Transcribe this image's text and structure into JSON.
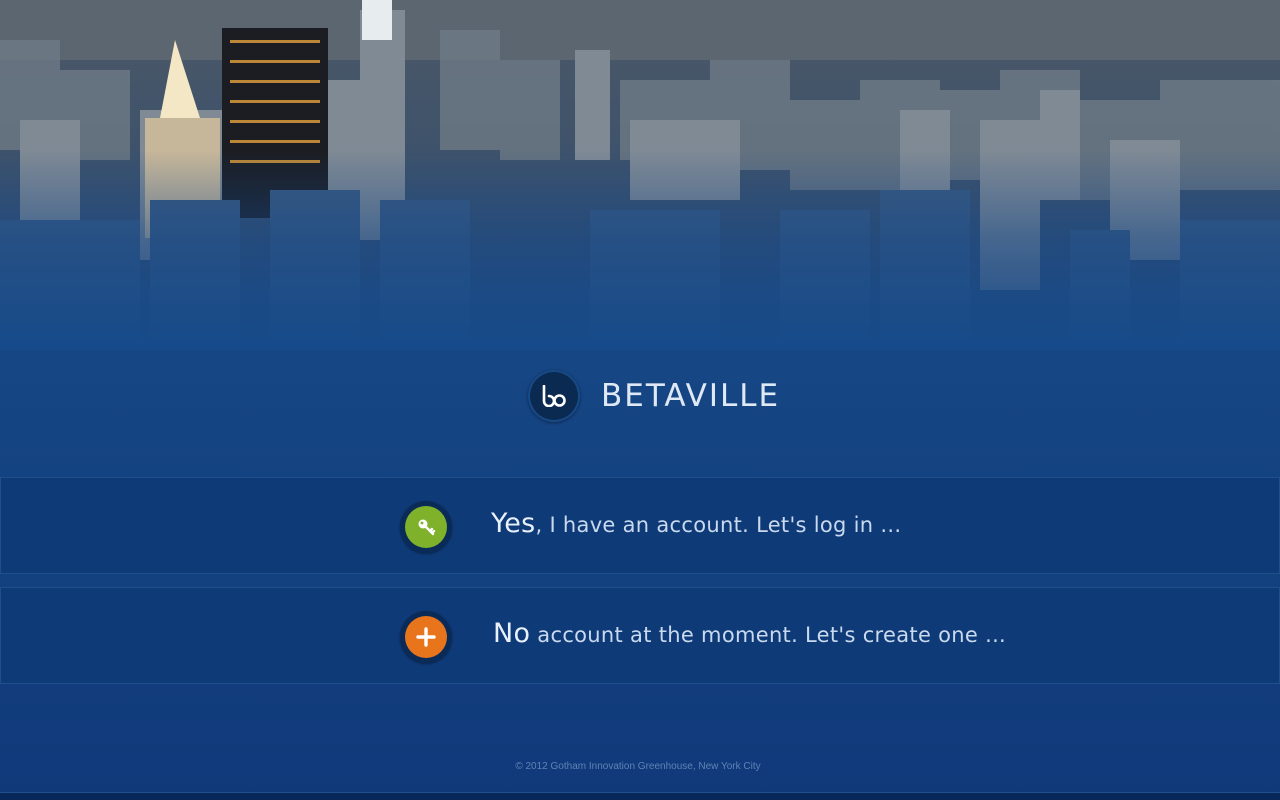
{
  "brand": {
    "logo_text": "bo",
    "name": "BETAVILLE"
  },
  "options": {
    "login": {
      "lead": "Yes",
      "rest": ", I have an account. Let's log in ...",
      "icon": "key-icon",
      "color": "#7fb22a"
    },
    "create": {
      "lead": "No",
      "rest": " account at the moment. Let's create one ...",
      "icon": "plus-icon",
      "color": "#e8741c"
    }
  },
  "footer": {
    "copyright": "© 2012 Gotham Innovation Greenhouse, New York City"
  },
  "colors": {
    "background": "#164684",
    "row": "#0e3a78",
    "accent_green": "#7fb22a",
    "accent_orange": "#e8741c"
  }
}
